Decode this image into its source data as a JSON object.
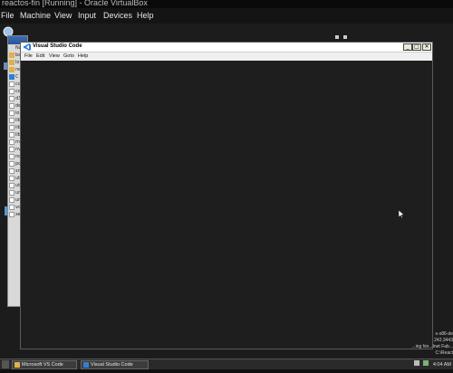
{
  "host": {
    "title": "reactos-fin [Running] - Oracle VirtualBox",
    "menu": [
      "File",
      "Machine",
      "View",
      "Input",
      "Devices",
      "Help"
    ]
  },
  "explorer": {
    "title": "Microsoft VS Code",
    "rows": [
      {
        "name": "Nam",
        "kind": "header"
      },
      {
        "name": "ba",
        "kind": "folder"
      },
      {
        "name": "lo",
        "kind": "folder"
      },
      {
        "name": "re",
        "kind": "folder"
      },
      {
        "name": "C",
        "kind": "vscode"
      },
      {
        "name": "co",
        "kind": "file"
      },
      {
        "name": "co",
        "kind": "file"
      },
      {
        "name": "d3",
        "kind": "file"
      },
      {
        "name": "de",
        "kind": "file"
      },
      {
        "name": "io",
        "kind": "file"
      },
      {
        "name": "lib",
        "kind": "file"
      },
      {
        "name": "lib",
        "kind": "file"
      },
      {
        "name": "lib",
        "kind": "file"
      },
      {
        "name": "m",
        "kind": "file"
      },
      {
        "name": "nv",
        "kind": "file"
      },
      {
        "name": "nc",
        "kind": "file"
      },
      {
        "name": "pc",
        "kind": "file"
      },
      {
        "name": "sn",
        "kind": "file"
      },
      {
        "name": "ut",
        "kind": "file"
      },
      {
        "name": "ut",
        "kind": "file"
      },
      {
        "name": "ur",
        "kind": "file"
      },
      {
        "name": "ur",
        "kind": "file"
      },
      {
        "name": "vc",
        "kind": "file"
      },
      {
        "name": "xe",
        "kind": "file"
      }
    ]
  },
  "vscode": {
    "title": "Visual Studio Code",
    "menu": [
      "File",
      "Edit",
      "View",
      "Goto",
      "Help"
    ],
    "min": "_",
    "max": "□",
    "close": "✕"
  },
  "side_text": {
    "line1": "s-x86-de",
    "line2": "242.3443",
    "line3": "...ing hin...Inet Fab...",
    "line4": "C:\\React"
  },
  "taskbar": {
    "buttons": [
      {
        "label": "Microsoft VS Code",
        "icon": "folder-icon"
      },
      {
        "label": "Visual Studio Code",
        "icon": "vscode-icon"
      }
    ],
    "time": "4:04 AM"
  },
  "colors": {
    "editor_bg": "#1e1e1e",
    "window_chrome": "#d4d0c8",
    "vscode_blue": "#2f7fd1"
  }
}
